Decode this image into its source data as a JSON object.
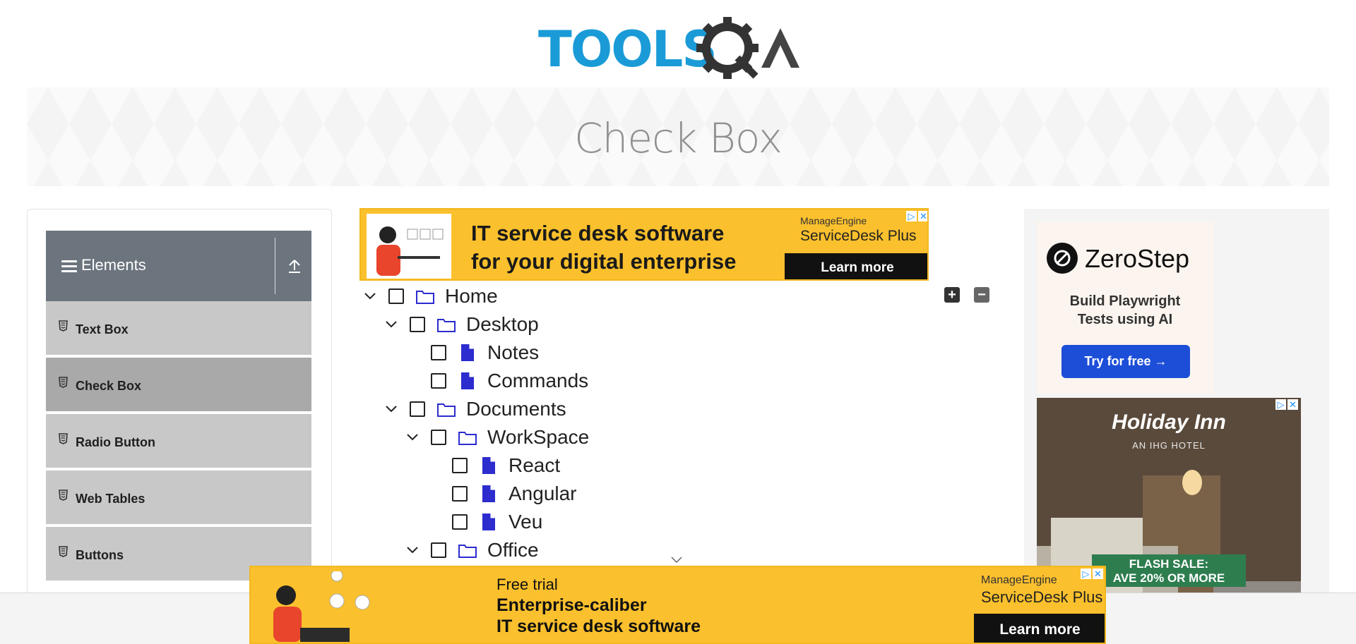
{
  "header": {
    "logo_text": "TOOLSQA",
    "page_title": "Check Box"
  },
  "sidebar": {
    "group_label": "Elements",
    "items": [
      {
        "label": "Text Box"
      },
      {
        "label": "Check Box",
        "active": true
      },
      {
        "label": "Radio Button"
      },
      {
        "label": "Web Tables"
      },
      {
        "label": "Buttons"
      }
    ]
  },
  "ad_top": {
    "headline_line1": "IT service desk software",
    "headline_line2": "for your digital enterprise",
    "brand_small": "ManageEngine",
    "brand_large": "ServiceDesk Plus",
    "cta": "Learn more"
  },
  "tree": {
    "expand_all_label": "+",
    "collapse_all_label": "−",
    "nodes": [
      {
        "label": "Home",
        "type": "folder",
        "expanded": true,
        "checked": false
      },
      {
        "label": "Desktop",
        "type": "folder",
        "expanded": true,
        "checked": false
      },
      {
        "label": "Notes",
        "type": "file",
        "checked": false
      },
      {
        "label": "Commands",
        "type": "file",
        "checked": false
      },
      {
        "label": "Documents",
        "type": "folder",
        "expanded": true,
        "checked": false
      },
      {
        "label": "WorkSpace",
        "type": "folder",
        "expanded": true,
        "checked": false
      },
      {
        "label": "React",
        "type": "file",
        "checked": false
      },
      {
        "label": "Angular",
        "type": "file",
        "checked": false
      },
      {
        "label": "Veu",
        "type": "file",
        "checked": false
      },
      {
        "label": "Office",
        "type": "folder",
        "expanded": true,
        "checked": false
      }
    ]
  },
  "ad_right_1": {
    "brand": "ZeroStep",
    "line1": "Build Playwright",
    "line2": "Tests using AI",
    "cta": "Try for free →"
  },
  "ad_right_2": {
    "title": "Holiday Inn",
    "subtitle": "AN IHG HOTEL",
    "sale_line1": "FLASH SALE:",
    "sale_line2": "AVE 20% OR MORE"
  },
  "ad_bottom": {
    "line1": "Free trial",
    "line2": "Enterprise-caliber",
    "line3": "IT service desk software",
    "brand_small": "ManageEngine",
    "brand_large": "ServiceDesk Plus",
    "cta": "Learn more"
  },
  "colors": {
    "brand_blue": "#1a9bd7",
    "sidebar_header": "#6c757d",
    "folder_icon": "#2c2ccf",
    "ad_yellow": "#fbc02d"
  }
}
